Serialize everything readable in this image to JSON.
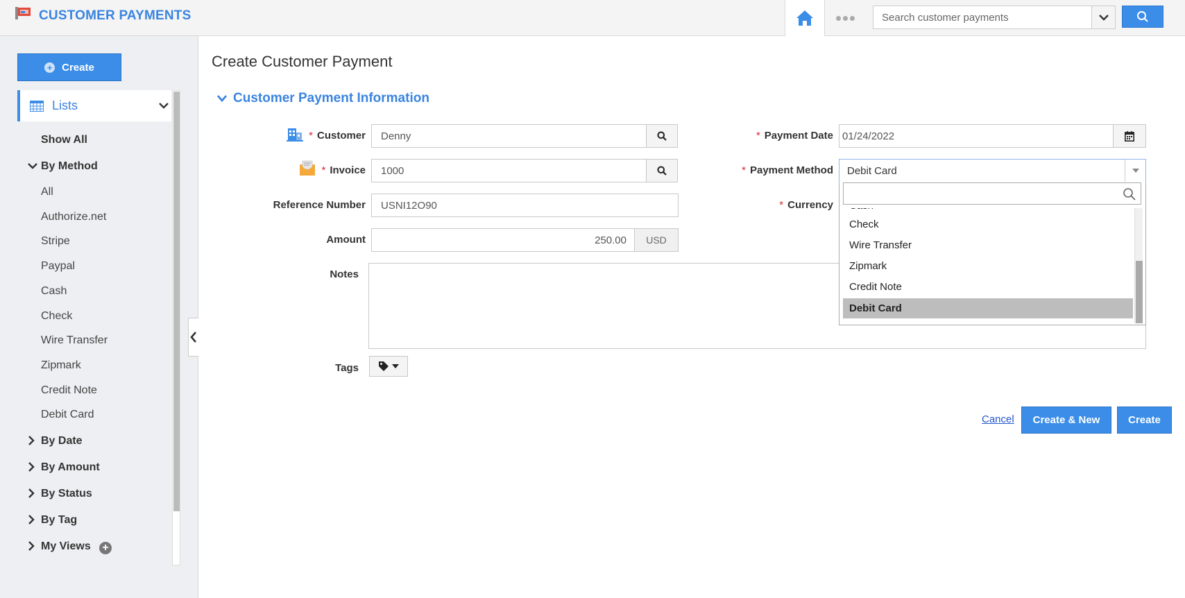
{
  "header": {
    "app_title": "CUSTOMER PAYMENTS",
    "search_placeholder": "Search customer payments"
  },
  "sidebar": {
    "create_label": "Create",
    "lists_label": "Lists",
    "show_all": "Show All",
    "by_method": "By Method",
    "methods": [
      "All",
      "Authorize.net",
      "Stripe",
      "Paypal",
      "Cash",
      "Check",
      "Wire Transfer",
      "Zipmark",
      "Credit Note",
      "Debit Card"
    ],
    "groups": [
      "By Date",
      "By Amount",
      "By Status",
      "By Tag",
      "My Views"
    ]
  },
  "main": {
    "page_title": "Create Customer Payment",
    "section_title": "Customer Payment Information",
    "fields": {
      "customer_label": "Customer",
      "customer_value": "Denny",
      "invoice_label": "Invoice",
      "invoice_value": "1000",
      "reference_label": "Reference Number",
      "reference_value": "USNI12O90",
      "amount_label": "Amount",
      "amount_value": "250.00",
      "amount_currency": "USD",
      "notes_label": "Notes",
      "tags_label": "Tags",
      "payment_date_label": "Payment Date",
      "payment_date_value": "01/24/2022",
      "payment_method_label": "Payment Method",
      "payment_method_value": "Debit Card",
      "currency_label": "Currency"
    },
    "dropdown": {
      "partial_option": "Cash",
      "options": [
        "Check",
        "Wire Transfer",
        "Zipmark",
        "Credit Note",
        "Debit Card"
      ],
      "selected": "Debit Card"
    },
    "actions": {
      "cancel": "Cancel",
      "create_new": "Create & New",
      "create": "Create"
    }
  },
  "colors": {
    "accent": "#3b8de8",
    "title_blue": "#3a84e0",
    "required": "#d9262c",
    "selected_option": "#bdbdbd"
  }
}
